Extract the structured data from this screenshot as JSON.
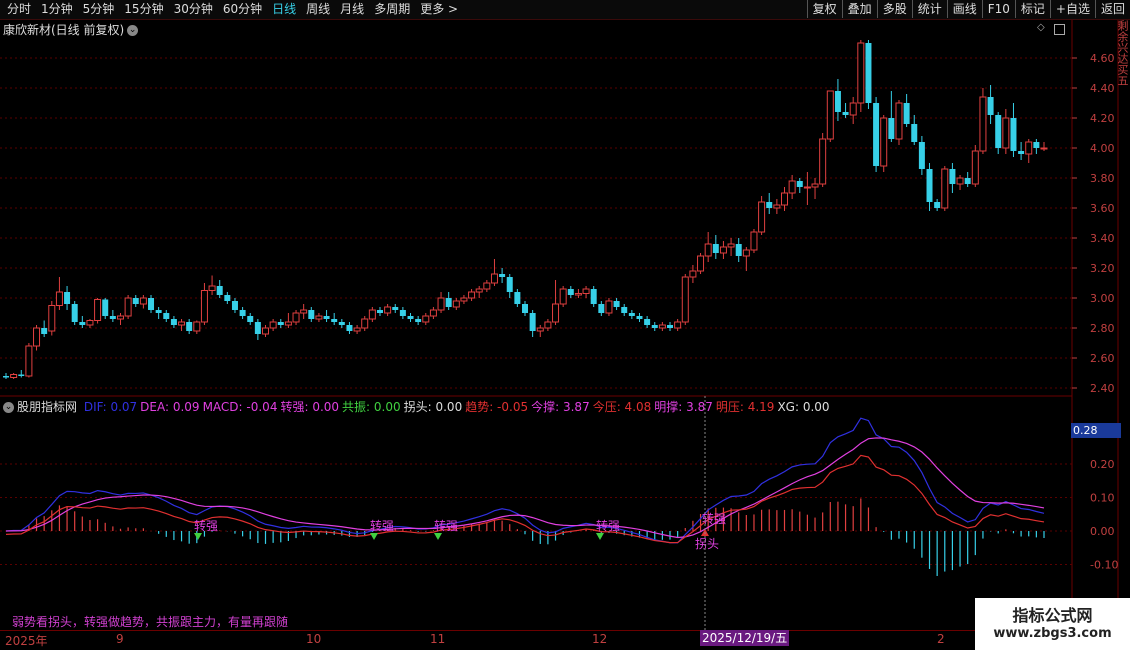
{
  "toolbar": {
    "periods": [
      "分时",
      "1分钟",
      "5分钟",
      "15分钟",
      "30分钟",
      "60分钟",
      "日线",
      "周线",
      "月线",
      "多周期",
      "更多 >"
    ],
    "active_index": 6,
    "buttons": [
      "复权",
      "叠加",
      "多股",
      "统计",
      "画线",
      "F10",
      "标记",
      "+自选",
      "返回"
    ]
  },
  "chart": {
    "title": "康欣新材(日线 前复权)",
    "price_labels": [
      "4.60",
      "4.40",
      "4.20",
      "4.00",
      "3.80",
      "3.60",
      "3.40",
      "3.20",
      "3.00",
      "2.80",
      "2.60",
      "2.40"
    ],
    "up_color": "#e04040",
    "down_color": "#37d0e8",
    "side_text": "剩余兴达买五",
    "candles": [
      {
        "o": 2.48,
        "h": 2.5,
        "l": 2.46,
        "c": 2.47
      },
      {
        "o": 2.47,
        "h": 2.5,
        "l": 2.46,
        "c": 2.49
      },
      {
        "o": 2.49,
        "h": 2.52,
        "l": 2.47,
        "c": 2.48
      },
      {
        "o": 2.48,
        "h": 2.7,
        "l": 2.47,
        "c": 2.68
      },
      {
        "o": 2.68,
        "h": 2.82,
        "l": 2.65,
        "c": 2.8
      },
      {
        "o": 2.8,
        "h": 2.85,
        "l": 2.74,
        "c": 2.76
      },
      {
        "o": 2.78,
        "h": 2.98,
        "l": 2.75,
        "c": 2.95
      },
      {
        "o": 2.95,
        "h": 3.14,
        "l": 2.92,
        "c": 3.04
      },
      {
        "o": 3.04,
        "h": 3.08,
        "l": 2.92,
        "c": 2.96
      },
      {
        "o": 2.96,
        "h": 2.98,
        "l": 2.82,
        "c": 2.84
      },
      {
        "o": 2.84,
        "h": 2.88,
        "l": 2.8,
        "c": 2.82
      },
      {
        "o": 2.82,
        "h": 2.86,
        "l": 2.8,
        "c": 2.85
      },
      {
        "o": 2.85,
        "h": 3.0,
        "l": 2.83,
        "c": 2.99
      },
      {
        "o": 2.99,
        "h": 3.0,
        "l": 2.86,
        "c": 2.88
      },
      {
        "o": 2.88,
        "h": 2.92,
        "l": 2.84,
        "c": 2.86
      },
      {
        "o": 2.86,
        "h": 2.9,
        "l": 2.82,
        "c": 2.88
      },
      {
        "o": 2.88,
        "h": 3.02,
        "l": 2.86,
        "c": 3.0
      },
      {
        "o": 3.0,
        "h": 3.02,
        "l": 2.94,
        "c": 2.96
      },
      {
        "o": 2.96,
        "h": 3.02,
        "l": 2.93,
        "c": 3.0
      },
      {
        "o": 3.0,
        "h": 3.02,
        "l": 2.9,
        "c": 2.92
      },
      {
        "o": 2.92,
        "h": 2.94,
        "l": 2.86,
        "c": 2.9
      },
      {
        "o": 2.9,
        "h": 2.92,
        "l": 2.84,
        "c": 2.86
      },
      {
        "o": 2.86,
        "h": 2.88,
        "l": 2.8,
        "c": 2.82
      },
      {
        "o": 2.82,
        "h": 2.86,
        "l": 2.78,
        "c": 2.84
      },
      {
        "o": 2.84,
        "h": 2.86,
        "l": 2.76,
        "c": 2.78
      },
      {
        "o": 2.78,
        "h": 2.85,
        "l": 2.76,
        "c": 2.84
      },
      {
        "o": 2.84,
        "h": 3.1,
        "l": 2.82,
        "c": 3.05
      },
      {
        "o": 3.05,
        "h": 3.15,
        "l": 3.02,
        "c": 3.08
      },
      {
        "o": 3.08,
        "h": 3.12,
        "l": 3.0,
        "c": 3.02
      },
      {
        "o": 3.02,
        "h": 3.04,
        "l": 2.96,
        "c": 2.98
      },
      {
        "o": 2.98,
        "h": 3.0,
        "l": 2.9,
        "c": 2.92
      },
      {
        "o": 2.92,
        "h": 2.94,
        "l": 2.86,
        "c": 2.88
      },
      {
        "o": 2.88,
        "h": 2.9,
        "l": 2.82,
        "c": 2.84
      },
      {
        "o": 2.84,
        "h": 2.86,
        "l": 2.72,
        "c": 2.76
      },
      {
        "o": 2.76,
        "h": 2.82,
        "l": 2.74,
        "c": 2.8
      },
      {
        "o": 2.8,
        "h": 2.86,
        "l": 2.78,
        "c": 2.84
      },
      {
        "o": 2.84,
        "h": 2.86,
        "l": 2.8,
        "c": 2.82
      },
      {
        "o": 2.82,
        "h": 2.9,
        "l": 2.8,
        "c": 2.84
      },
      {
        "o": 2.84,
        "h": 2.92,
        "l": 2.82,
        "c": 2.9
      },
      {
        "o": 2.9,
        "h": 2.96,
        "l": 2.86,
        "c": 2.92
      },
      {
        "o": 2.92,
        "h": 2.94,
        "l": 2.84,
        "c": 2.86
      },
      {
        "o": 2.86,
        "h": 2.9,
        "l": 2.84,
        "c": 2.88
      },
      {
        "o": 2.88,
        "h": 2.92,
        "l": 2.84,
        "c": 2.86
      },
      {
        "o": 2.86,
        "h": 2.9,
        "l": 2.82,
        "c": 2.84
      },
      {
        "o": 2.84,
        "h": 2.86,
        "l": 2.8,
        "c": 2.82
      },
      {
        "o": 2.82,
        "h": 2.84,
        "l": 2.76,
        "c": 2.78
      },
      {
        "o": 2.78,
        "h": 2.82,
        "l": 2.76,
        "c": 2.8
      },
      {
        "o": 2.8,
        "h": 2.88,
        "l": 2.78,
        "c": 2.86
      },
      {
        "o": 2.86,
        "h": 2.94,
        "l": 2.84,
        "c": 2.92
      },
      {
        "o": 2.92,
        "h": 2.94,
        "l": 2.88,
        "c": 2.9
      },
      {
        "o": 2.9,
        "h": 2.96,
        "l": 2.88,
        "c": 2.94
      },
      {
        "o": 2.94,
        "h": 2.96,
        "l": 2.9,
        "c": 2.92
      },
      {
        "o": 2.92,
        "h": 2.94,
        "l": 2.86,
        "c": 2.88
      },
      {
        "o": 2.88,
        "h": 2.9,
        "l": 2.84,
        "c": 2.86
      },
      {
        "o": 2.86,
        "h": 2.88,
        "l": 2.82,
        "c": 2.84
      },
      {
        "o": 2.84,
        "h": 2.9,
        "l": 2.82,
        "c": 2.88
      },
      {
        "o": 2.88,
        "h": 2.94,
        "l": 2.86,
        "c": 2.92
      },
      {
        "o": 2.92,
        "h": 3.04,
        "l": 2.9,
        "c": 3.0
      },
      {
        "o": 3.0,
        "h": 3.04,
        "l": 2.92,
        "c": 2.94
      },
      {
        "o": 2.94,
        "h": 3.0,
        "l": 2.92,
        "c": 2.98
      },
      {
        "o": 2.98,
        "h": 3.02,
        "l": 2.96,
        "c": 3.0
      },
      {
        "o": 3.0,
        "h": 3.06,
        "l": 2.98,
        "c": 3.04
      },
      {
        "o": 3.04,
        "h": 3.08,
        "l": 3.0,
        "c": 3.06
      },
      {
        "o": 3.06,
        "h": 3.12,
        "l": 3.04,
        "c": 3.1
      },
      {
        "o": 3.1,
        "h": 3.26,
        "l": 3.08,
        "c": 3.16
      },
      {
        "o": 3.16,
        "h": 3.2,
        "l": 3.1,
        "c": 3.14
      },
      {
        "o": 3.14,
        "h": 3.16,
        "l": 3.0,
        "c": 3.04
      },
      {
        "o": 3.04,
        "h": 3.06,
        "l": 2.94,
        "c": 2.96
      },
      {
        "o": 2.96,
        "h": 2.98,
        "l": 2.88,
        "c": 2.9
      },
      {
        "o": 2.9,
        "h": 2.92,
        "l": 2.74,
        "c": 2.78
      },
      {
        "o": 2.78,
        "h": 2.82,
        "l": 2.74,
        "c": 2.8
      },
      {
        "o": 2.8,
        "h": 2.86,
        "l": 2.78,
        "c": 2.84
      },
      {
        "o": 2.84,
        "h": 3.12,
        "l": 2.82,
        "c": 2.96
      },
      {
        "o": 2.96,
        "h": 3.08,
        "l": 2.94,
        "c": 3.06
      },
      {
        "o": 3.06,
        "h": 3.08,
        "l": 3.0,
        "c": 3.02
      },
      {
        "o": 3.02,
        "h": 3.06,
        "l": 3.0,
        "c": 3.03
      },
      {
        "o": 3.03,
        "h": 3.08,
        "l": 3.0,
        "c": 3.06
      },
      {
        "o": 3.06,
        "h": 3.08,
        "l": 2.94,
        "c": 2.96
      },
      {
        "o": 2.96,
        "h": 2.98,
        "l": 2.88,
        "c": 2.9
      },
      {
        "o": 2.9,
        "h": 3.0,
        "l": 2.88,
        "c": 2.98
      },
      {
        "o": 2.98,
        "h": 3.0,
        "l": 2.92,
        "c": 2.94
      },
      {
        "o": 2.94,
        "h": 2.96,
        "l": 2.88,
        "c": 2.9
      },
      {
        "o": 2.9,
        "h": 2.92,
        "l": 2.86,
        "c": 2.88
      },
      {
        "o": 2.88,
        "h": 2.9,
        "l": 2.84,
        "c": 2.86
      },
      {
        "o": 2.86,
        "h": 2.88,
        "l": 2.8,
        "c": 2.82
      },
      {
        "o": 2.82,
        "h": 2.84,
        "l": 2.78,
        "c": 2.8
      },
      {
        "o": 2.8,
        "h": 2.84,
        "l": 2.78,
        "c": 2.82
      },
      {
        "o": 2.82,
        "h": 2.84,
        "l": 2.78,
        "c": 2.8
      },
      {
        "o": 2.8,
        "h": 2.86,
        "l": 2.78,
        "c": 2.84
      },
      {
        "o": 2.84,
        "h": 3.16,
        "l": 2.82,
        "c": 3.14
      },
      {
        "o": 3.14,
        "h": 3.22,
        "l": 3.1,
        "c": 3.18
      },
      {
        "o": 3.18,
        "h": 3.3,
        "l": 3.16,
        "c": 3.28
      },
      {
        "o": 3.28,
        "h": 3.44,
        "l": 3.24,
        "c": 3.36
      },
      {
        "o": 3.36,
        "h": 3.42,
        "l": 3.26,
        "c": 3.3
      },
      {
        "o": 3.3,
        "h": 3.38,
        "l": 3.26,
        "c": 3.34
      },
      {
        "o": 3.34,
        "h": 3.4,
        "l": 3.28,
        "c": 3.36
      },
      {
        "o": 3.36,
        "h": 3.4,
        "l": 3.24,
        "c": 3.28
      },
      {
        "o": 3.28,
        "h": 3.34,
        "l": 3.18,
        "c": 3.32
      },
      {
        "o": 3.32,
        "h": 3.46,
        "l": 3.3,
        "c": 3.44
      },
      {
        "o": 3.44,
        "h": 3.68,
        "l": 3.42,
        "c": 3.64
      },
      {
        "o": 3.64,
        "h": 3.7,
        "l": 3.56,
        "c": 3.6
      },
      {
        "o": 3.6,
        "h": 3.66,
        "l": 3.56,
        "c": 3.62
      },
      {
        "o": 3.62,
        "h": 3.74,
        "l": 3.58,
        "c": 3.7
      },
      {
        "o": 3.7,
        "h": 3.82,
        "l": 3.66,
        "c": 3.78
      },
      {
        "o": 3.78,
        "h": 3.8,
        "l": 3.7,
        "c": 3.74
      },
      {
        "o": 3.74,
        "h": 3.84,
        "l": 3.62,
        "c": 3.74
      },
      {
        "o": 3.74,
        "h": 3.8,
        "l": 3.66,
        "c": 3.76
      },
      {
        "o": 3.76,
        "h": 4.1,
        "l": 3.74,
        "c": 4.06
      },
      {
        "o": 4.06,
        "h": 4.38,
        "l": 4.04,
        "c": 4.38
      },
      {
        "o": 4.38,
        "h": 4.46,
        "l": 4.18,
        "c": 4.24
      },
      {
        "o": 4.24,
        "h": 4.3,
        "l": 4.2,
        "c": 4.22
      },
      {
        "o": 4.22,
        "h": 4.34,
        "l": 4.16,
        "c": 4.3
      },
      {
        "o": 4.3,
        "h": 4.72,
        "l": 4.24,
        "c": 4.7
      },
      {
        "o": 4.7,
        "h": 4.72,
        "l": 4.26,
        "c": 4.3
      },
      {
        "o": 4.3,
        "h": 4.34,
        "l": 3.84,
        "c": 3.88
      },
      {
        "o": 3.88,
        "h": 4.22,
        "l": 3.84,
        "c": 4.2
      },
      {
        "o": 4.2,
        "h": 4.38,
        "l": 4.04,
        "c": 4.06
      },
      {
        "o": 4.06,
        "h": 4.32,
        "l": 4.02,
        "c": 4.3
      },
      {
        "o": 4.3,
        "h": 4.36,
        "l": 4.14,
        "c": 4.16
      },
      {
        "o": 4.16,
        "h": 4.22,
        "l": 4.02,
        "c": 4.04
      },
      {
        "o": 4.04,
        "h": 4.08,
        "l": 3.82,
        "c": 3.86
      },
      {
        "o": 3.86,
        "h": 3.9,
        "l": 3.58,
        "c": 3.64
      },
      {
        "o": 3.64,
        "h": 3.66,
        "l": 3.58,
        "c": 3.6
      },
      {
        "o": 3.6,
        "h": 3.88,
        "l": 3.58,
        "c": 3.86
      },
      {
        "o": 3.86,
        "h": 3.9,
        "l": 3.7,
        "c": 3.76
      },
      {
        "o": 3.76,
        "h": 3.82,
        "l": 3.72,
        "c": 3.8
      },
      {
        "o": 3.8,
        "h": 3.84,
        "l": 3.74,
        "c": 3.76
      },
      {
        "o": 3.76,
        "h": 4.02,
        "l": 3.74,
        "c": 3.98
      },
      {
        "o": 3.98,
        "h": 4.4,
        "l": 3.96,
        "c": 4.34
      },
      {
        "o": 4.34,
        "h": 4.42,
        "l": 4.16,
        "c": 4.22
      },
      {
        "o": 4.22,
        "h": 4.24,
        "l": 3.96,
        "c": 4.0
      },
      {
        "o": 4.0,
        "h": 4.26,
        "l": 3.96,
        "c": 4.2
      },
      {
        "o": 4.2,
        "h": 4.3,
        "l": 3.94,
        "c": 3.98
      },
      {
        "o": 3.98,
        "h": 4.04,
        "l": 3.92,
        "c": 3.96
      },
      {
        "o": 3.96,
        "h": 4.06,
        "l": 3.9,
        "c": 4.04
      },
      {
        "o": 4.04,
        "h": 4.06,
        "l": 3.96,
        "c": 4.0
      },
      {
        "o": 4.0,
        "h": 4.04,
        "l": 3.98,
        "c": 4.0
      }
    ]
  },
  "indicator": {
    "name": "股朋指标网",
    "fields": [
      {
        "label": "DIF: 0.07",
        "color": "#3030e0"
      },
      {
        "label": "DEA: 0.09",
        "color": "#e040e0"
      },
      {
        "label": "MACD: -0.04",
        "color": "#e040e0"
      },
      {
        "label": "转强: 0.00",
        "color": "#e040e0"
      },
      {
        "label": "共振: 0.00",
        "color": "#40d040"
      },
      {
        "label": "拐头: 0.00",
        "color": "#dddddd"
      },
      {
        "label": "趋势: -0.05",
        "color": "#e03030"
      },
      {
        "label": "今撑: 3.87",
        "color": "#e040e0"
      },
      {
        "label": "今压: 4.08",
        "color": "#e03030"
      },
      {
        "label": "明撑: 3.87",
        "color": "#e040e0"
      },
      {
        "label": "明压: 4.19",
        "color": "#e03030"
      },
      {
        "label": "XG: 0.00",
        "color": "#dddddd"
      }
    ],
    "axis_labels": [
      "0.20",
      "0.10",
      "0.00",
      "-0.10"
    ],
    "value_badge": "0.28",
    "signal_labels": [
      "转强",
      "转强",
      "转强",
      "转强",
      "转强"
    ],
    "turn_label": "拐头",
    "slogan": "弱势看拐头，转强做趋势，共振跟主力，有量再跟随"
  },
  "dates": {
    "year": "2025年",
    "months": [
      "9",
      "10",
      "11",
      "12",
      "2"
    ],
    "highlight": "2025/12/19/五"
  },
  "watermark": {
    "line1": "指标公式网",
    "line2": "www.zbgs3.com"
  }
}
